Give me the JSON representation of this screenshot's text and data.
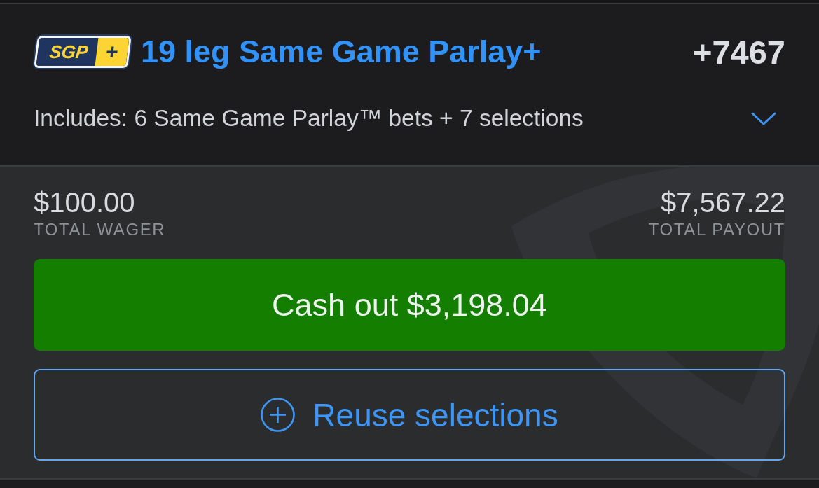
{
  "header": {
    "badge": {
      "label": "SGP",
      "symbol": "+"
    },
    "title": "19 leg Same Game Parlay+",
    "odds": "+7467",
    "includes": "Includes: 6 Same Game Parlay™ bets + 7 selections",
    "expanded": false
  },
  "totals": [
    {
      "amount": "$100.00",
      "label": "TOTAL WAGER"
    },
    {
      "amount": "$7,567.22",
      "label": "TOTAL PAYOUT"
    }
  ],
  "buttons": [
    {
      "kind": "cashout",
      "label": "Cash out $3,198.04"
    },
    {
      "kind": "reuse",
      "label": "Reuse selections"
    }
  ]
}
